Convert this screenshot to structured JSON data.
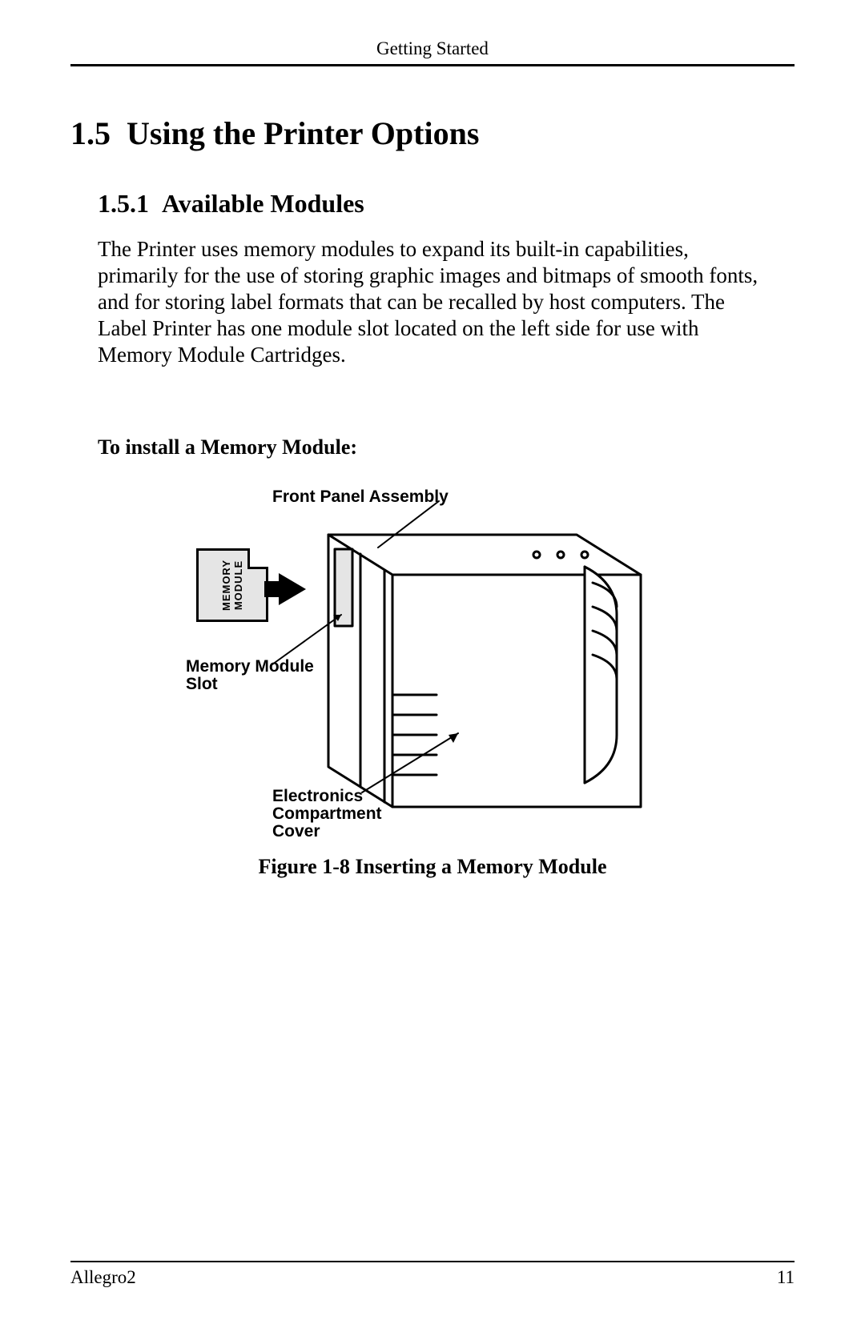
{
  "header": {
    "chapter_title": "Getting Started"
  },
  "section": {
    "number": "1.5",
    "title": "Using the Printer Options",
    "subsection_number": "1.5.1",
    "subsection_title": "Available Modules",
    "body": "The Printer uses memory modules to expand its built-in capabilities, primarily for the use of storing graphic images and bitmaps of smooth fonts, and for storing label formats that can be recalled by host computers. The Label Printer has one module slot located on the left side for use with Memory Module Cartridges.",
    "install_heading": "To install a Memory Module:"
  },
  "figure": {
    "label_front_panel": "Front Panel Assembly",
    "label_memory_slot_l1": "Memory Module",
    "label_memory_slot_l2": "Slot",
    "label_elec_l1": "Electronics",
    "label_elec_l2": "Compartment",
    "label_elec_l3": "Cover",
    "memcard_text_l1": "MEMORY",
    "memcard_text_l2": "MODULE",
    "caption_prefix": "Figure 1-8   ",
    "caption_title": "Inserting a Memory Module"
  },
  "footer": {
    "product": "Allegro2",
    "page": "11"
  }
}
